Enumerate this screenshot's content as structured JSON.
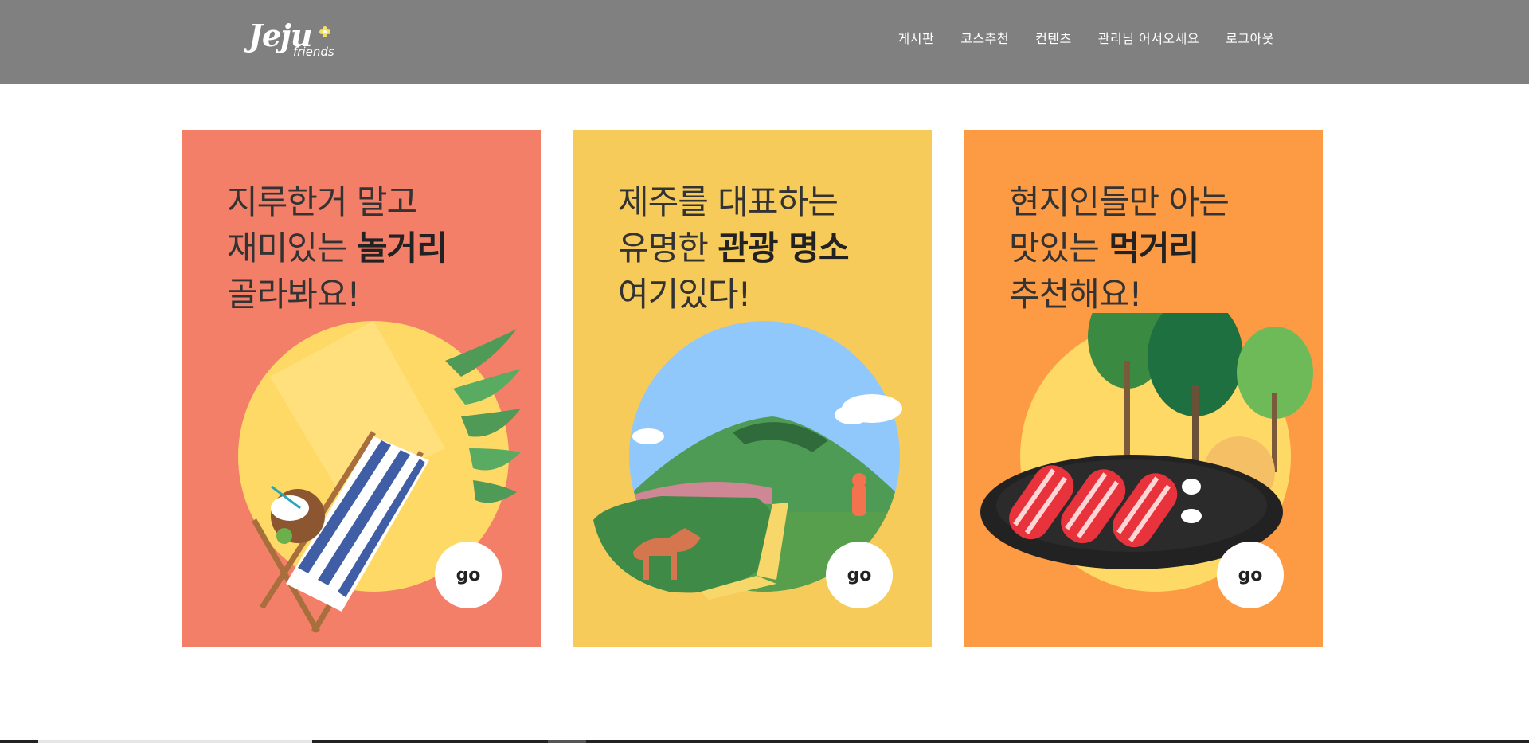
{
  "header": {
    "logo": {
      "main": "Jeju",
      "sub": "friends"
    },
    "nav": [
      {
        "key": "board",
        "label": "게시판"
      },
      {
        "key": "course",
        "label": "코스추천"
      },
      {
        "key": "contents",
        "label": "컨텐츠"
      },
      {
        "key": "greeting",
        "label": "관리님 어서오세요"
      },
      {
        "key": "logout",
        "label": "로그아웃"
      }
    ]
  },
  "cards": [
    {
      "line1": "지루한거 말고",
      "line2_normal": "재미있는 ",
      "line2_bold": "놀거리",
      "line3": "골라봐요!",
      "go": "go",
      "bg": "#f37f69",
      "art": "beach-chair"
    },
    {
      "line1": "제주를 대표하는",
      "line2_normal": "유명한 ",
      "line2_bold": "관광 명소",
      "line3": "여기있다!",
      "go": "go",
      "bg": "#f7cb5a",
      "art": "landscape"
    },
    {
      "line1": "현지인들만 아는",
      "line2_normal": "맛있는 ",
      "line2_bold": "먹거리",
      "line3": "추천해요!",
      "go": "go",
      "bg": "#fd9b45",
      "art": "grill"
    }
  ],
  "colors": {
    "header_bg": "#808080",
    "circle_yellow": "#ffd966",
    "sky_blue": "#90c8fc"
  }
}
